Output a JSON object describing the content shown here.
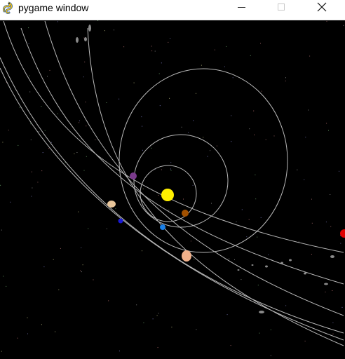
{
  "window": {
    "title": "pygame window",
    "icons": {
      "app": "pygame-snake-icon",
      "minimize": "minimize-icon",
      "maximize": "maximize-icon",
      "close": "close-icon"
    }
  },
  "scene": {
    "background": "#000000",
    "orbit_color": "#b8b8b8",
    "sun": {
      "name": "sun",
      "color": "#ffef00"
    },
    "planets": [
      {
        "name": "planet-brown",
        "color": "#a15000"
      },
      {
        "name": "planet-purple",
        "color": "#7a3a8c"
      },
      {
        "name": "planet-blue",
        "color": "#1a7fe6"
      },
      {
        "name": "planet-tan",
        "color": "#e8c59a"
      },
      {
        "name": "planet-peach",
        "color": "#f1b08a"
      },
      {
        "name": "planet-navy",
        "color": "#1a1ad6"
      },
      {
        "name": "planet-red",
        "color": "#e00000"
      }
    ]
  }
}
